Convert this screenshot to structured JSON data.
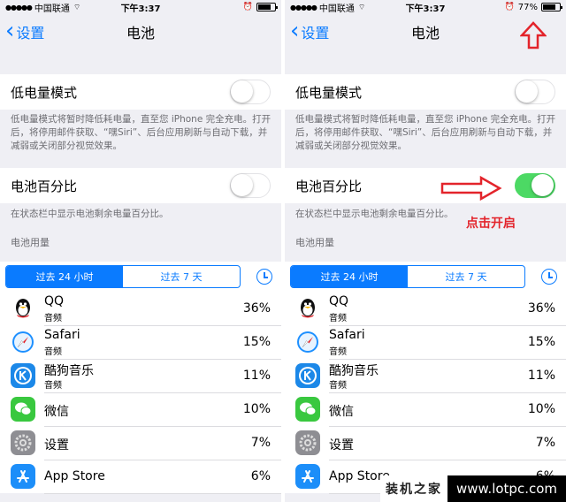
{
  "statusbar": {
    "left_carrier": "中国联通",
    "right_carrier": "中国联通",
    "left_time": "下午3:37",
    "right_time": "下午3:37",
    "battery_percent_label": "77%",
    "battery_level": 0.77
  },
  "nav": {
    "back_label": "设置",
    "title": "电池"
  },
  "low_power": {
    "label": "低电量模式",
    "description": "低电量模式将暂时降低耗电量，直至您 iPhone 完全充电。打开后，将停用邮件获取、“嘿Siri”、后台应用刷新与自动下载，并减弱或关闭部分视觉效果。"
  },
  "battery_percentage": {
    "label": "电池百分比",
    "description": "在状态栏中显示电池剩余电量百分比。",
    "left_state": "off",
    "right_state": "on"
  },
  "usage": {
    "section_title": "电池用量",
    "tabs": [
      "过去 24 小时",
      "过去 7 天"
    ],
    "active_tab": 0
  },
  "apps": [
    {
      "name": "QQ",
      "sub": "音频",
      "pct": "36%",
      "icon": "qq-penguin-icon"
    },
    {
      "name": "Safari",
      "sub": "音频",
      "pct": "15%",
      "icon": "safari-compass-icon"
    },
    {
      "name": "酷狗音乐",
      "sub": "音频",
      "pct": "11%",
      "icon": "kugou-icon"
    },
    {
      "name": "微信",
      "sub": "",
      "pct": "10%",
      "icon": "wechat-icon"
    },
    {
      "name": "设置",
      "sub": "",
      "pct": "7%",
      "icon": "settings-gear-icon"
    },
    {
      "name": "App Store",
      "sub": "",
      "pct": "6%",
      "icon": "app-store-icon"
    }
  ],
  "annotation": {
    "click_hint": "点击开启",
    "color": "#e3242b"
  },
  "watermark": {
    "cn": "装机之家",
    "url": "www.lotpc.com"
  },
  "colors": {
    "accent": "#0a7bff",
    "toggle_on": "#4cd964",
    "background": "#efeff4"
  }
}
